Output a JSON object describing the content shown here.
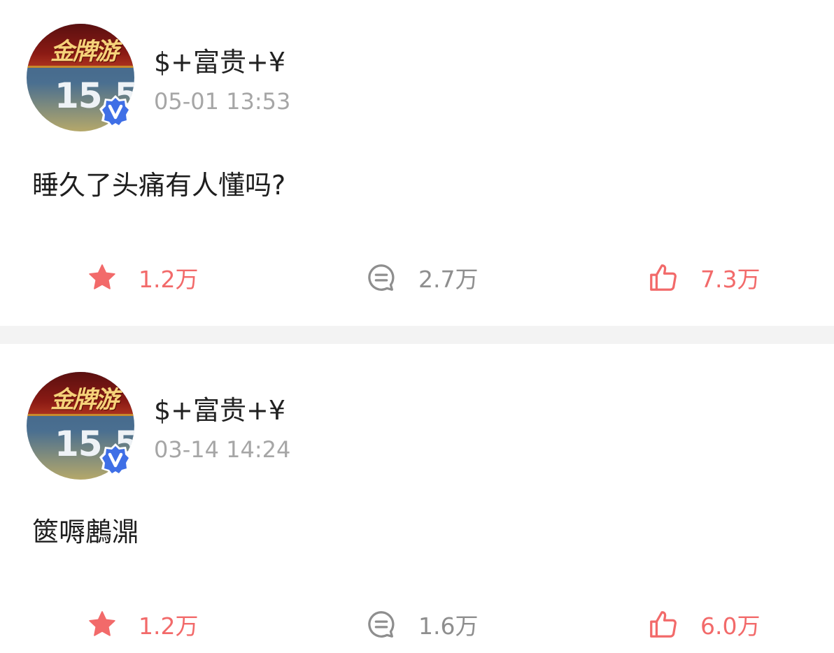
{
  "posts": [
    {
      "username": "$+富贵+¥",
      "time": "05-01 13:53",
      "content": "睡久了头痛有人懂吗?",
      "avatar_banner": "金牌游",
      "avatar_number": "15.5",
      "favorites": "1.2万",
      "comments": "2.7万",
      "likes": "7.3万"
    },
    {
      "username": "$+富贵+¥",
      "time": "03-14 14:24",
      "content": "篋嗕鶶濎",
      "avatar_banner": "金牌游",
      "avatar_number": "15.5",
      "favorites": "1.2万",
      "comments": "1.6万",
      "likes": "6.0万"
    }
  ],
  "icons": {
    "favorite": "star-icon",
    "comment": "comment-icon",
    "like": "thumbs-up-icon",
    "verified": "verified-v-badge-icon"
  },
  "colors": {
    "accent_red": "#f26a6a",
    "gray_text": "#8e8e8e",
    "verified_blue": "#3f6fe6",
    "divider": "#f3f3f3"
  }
}
